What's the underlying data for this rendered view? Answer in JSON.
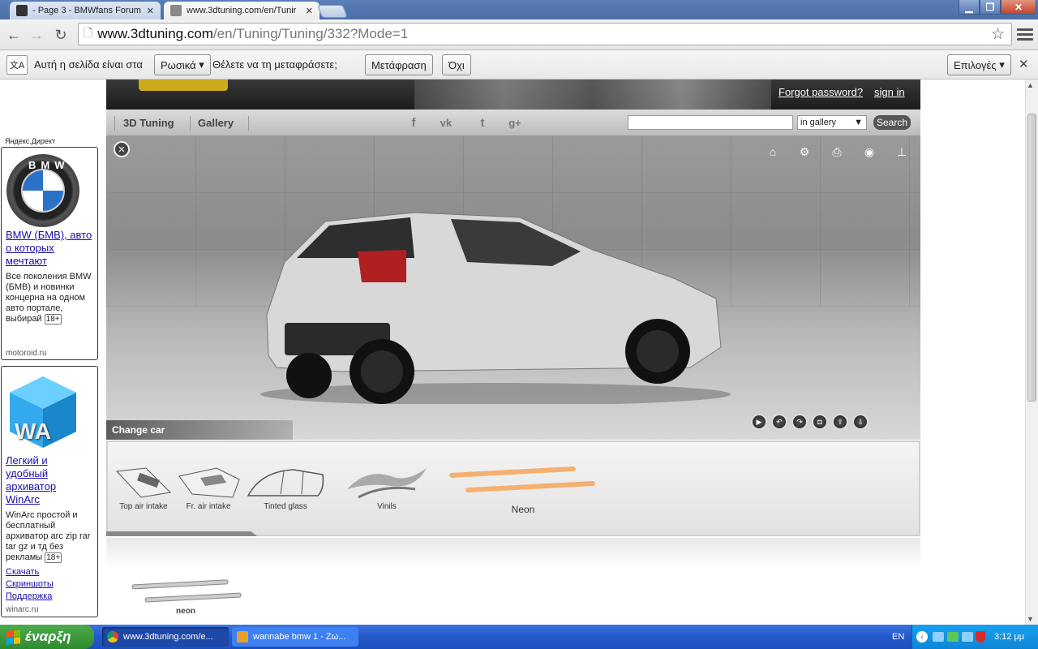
{
  "browser": {
    "tabs": [
      {
        "title": "- Page 3 - BMWfans Forum |",
        "active": false
      },
      {
        "title": "www.3dtuning.com/en/Tunir",
        "active": true
      }
    ],
    "url_host": "www.3dtuning.com",
    "url_path": "/en/Tuning/Tuning/332?Mode=1"
  },
  "translate_bar": {
    "prefix": "Αυτή η σελίδα είναι στα",
    "language": "Ρωσικά",
    "question": "Θέλετε να τη μεταφράσετε;",
    "translate_label": "Μετάφραση",
    "no_label": "Όχι",
    "options_label": "Επιλογές"
  },
  "ads": {
    "header": "Яндекс.Директ",
    "ad1": {
      "logo": "BMW",
      "link": "BMW (БМВ), авто о которых мечтают",
      "body": "Все поколения BMW (БМВ) и новинки концерна на одном авто портале, выбирай",
      "age": "18+",
      "domain": "motoroid.ru"
    },
    "ad2": {
      "logo": "WA",
      "link": "Легкий и удобный архиватор WinArc",
      "body": "WinArc простой и бесплатный архиватор arc zip rar tar gz и тд без рекламы",
      "age": "18+",
      "links": [
        "Скачать",
        "Скриншоты",
        "Поддержка"
      ],
      "domain": "winarc.ru"
    }
  },
  "site": {
    "banner": {
      "forgot": "Forgot password?",
      "signin": "sign in"
    },
    "nav": [
      "3D Tuning",
      "Gallery"
    ],
    "search_select": "in gallery",
    "search_button": "Search",
    "change_car": "Change car",
    "parts": [
      {
        "label": "Top air intake"
      },
      {
        "label": "Fr. air intake"
      },
      {
        "label": "Tinted glass"
      },
      {
        "label": "Vinils"
      },
      {
        "label": "Neon"
      }
    ],
    "sub_item": "neon"
  },
  "taskbar": {
    "start": "έναρξη",
    "tasks": [
      "www.3dtuning.com/e...",
      "wannabe bmw 1 - Ζω..."
    ],
    "lang": "EN",
    "time": "3:12 μμ"
  },
  "colors": {
    "accent": "#1a0dab",
    "taskbar": "#2458c9",
    "neon": "#f5b070"
  }
}
